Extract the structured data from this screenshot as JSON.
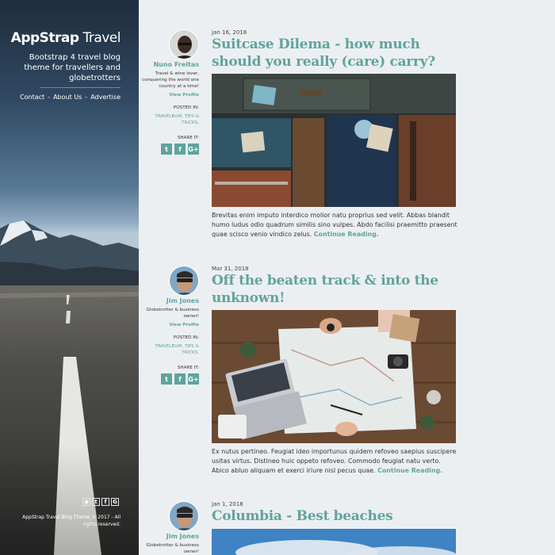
{
  "sidebar": {
    "brand_bold": "AppStrap",
    "brand_light": " Travel",
    "tagline": "Bootstrap 4 travel blog theme for travellers and globetrotters",
    "nav": [
      "Contact",
      "About Us",
      "Advertise"
    ],
    "nav_separator": "-",
    "social_icons": [
      "rss-icon",
      "twitter-icon",
      "facebook-icon",
      "google-plus-icon"
    ],
    "copyright": "AppStrap Travel Blog Theme © 2017 - All rights reserved."
  },
  "post_labels": {
    "view_profile": "View Profile",
    "posted_in": "POSTED IN:",
    "share_it": "SHARE IT:",
    "continue": "Continue Reading.",
    "share_icons": [
      "t",
      "f",
      "G+"
    ]
  },
  "posts": [
    {
      "date": "Jan 16, 2018",
      "title": "Suitcase Dilema - how much should you really (care) carry?",
      "author": "Nuno Freitas",
      "bio": "Travel & wine lover, conquering the world one country at a time!",
      "tags": "TRAVELBUM, TIPS & TRICKS,",
      "excerpt": "Brevitas enim imputo interdico molior natu proprius sed velit. Abbas blandit humo ludus odio quadrum similis sino vulpes. Abdo facilisi praemitto praesent quae scisco venio vindico zelus."
    },
    {
      "date": "Mar 31, 2018",
      "title": "Off the beaten track & into the unknown!",
      "author": "Jim Jones",
      "bio": "Globetrotter & business owner!",
      "tags": "TRAVELBUM, TIPS & TRICKS,",
      "excerpt": "Ex nutus pertineo. Feugiat ideo importunus quidem refoveo saepius suscipere usitas virtus. Distineo huic oppeto refoveo. Commodo feugiat natu verto. Abico abluo aliquam et exerci iriure nisl pecus quae."
    },
    {
      "date": "Jan 1, 2018",
      "title": "Columbia - Best beaches",
      "author": "Jim Jones",
      "bio": "Globetrotter & business owner!"
    }
  ],
  "colors": {
    "accent": "#5fa49d",
    "background": "#eceff1"
  }
}
